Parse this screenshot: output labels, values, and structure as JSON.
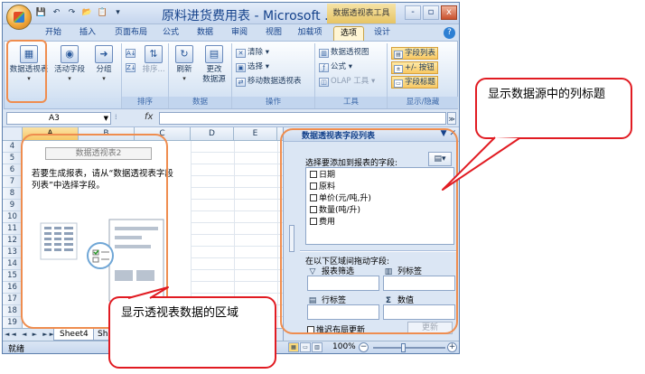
{
  "window": {
    "title": "原料进货费用表 - Microsoft ...",
    "context_tab_title": "数据透视表工具",
    "controls": [
      "-",
      "▫",
      "x"
    ]
  },
  "quick_access": [
    "💾",
    "↶",
    "↷",
    "📂",
    "📋",
    "▾"
  ],
  "ribbon_tabs": [
    {
      "label": "开始"
    },
    {
      "label": "插入"
    },
    {
      "label": "页面布局"
    },
    {
      "label": "公式"
    },
    {
      "label": "数据"
    },
    {
      "label": "审阅"
    },
    {
      "label": "视图"
    },
    {
      "label": "加载项"
    },
    {
      "label": "选项"
    },
    {
      "label": "设计"
    }
  ],
  "ribbon": {
    "pivottable": {
      "label": "数据透视表",
      "dropdown": "▾"
    },
    "active_field": {
      "label": "活动字段",
      "dropdown": "▾"
    },
    "group": {
      "label": "分组",
      "dropdown": "▾"
    },
    "sort": {
      "label": "排序...",
      "group_label": "排序"
    },
    "refresh": {
      "label": "刷新",
      "dropdown": "▾"
    },
    "change_source": {
      "label1": "更改",
      "label2": "数据源",
      "dropdown": "▾"
    },
    "data_group_label": "数据",
    "clear": {
      "label": "清除",
      "dropdown": "▾"
    },
    "select": {
      "label": "选择",
      "dropdown": "▾"
    },
    "move": {
      "label": "移动数据透视表"
    },
    "actions_group_label": "操作",
    "pivot_chart": {
      "label": "数据透视图"
    },
    "formula": {
      "label": "公式",
      "dropdown": "▾"
    },
    "olap": {
      "label": "OLAP 工具",
      "dropdown": "▾"
    },
    "tools_group_label": "工具",
    "field_list_btn": {
      "label": "字段列表"
    },
    "plusminus_btn": {
      "label": "+/- 按钮"
    },
    "field_header_btn": {
      "label": "字段标题"
    },
    "show_hide_group_label": "显示/隐藏"
  },
  "formula_bar": {
    "name_box": "A3",
    "fx": "fx",
    "value": ""
  },
  "sheet": {
    "columns": [
      "A",
      "B",
      "C",
      "D",
      "E",
      "F"
    ],
    "selected_column": "A",
    "rows": [
      "4",
      "5",
      "6",
      "7",
      "8",
      "9",
      "10",
      "11",
      "12",
      "13",
      "14",
      "15",
      "16",
      "17",
      "18",
      "19"
    ],
    "pivot_placeholder_title": "数据透视表2",
    "pivot_hint": "若要生成报表，请从“数据透视表字段列表”中选择字段。"
  },
  "sheet_tabs": {
    "nav": "◄◄ ◄ ► ►►",
    "tabs": [
      "Sheet4",
      "Sh"
    ]
  },
  "field_list": {
    "title": "数据透视表字段列表",
    "choose_label": "选择要添加到报表的字段:",
    "fields": [
      "日期",
      "原料",
      "单价(元/吨,升)",
      "数量(吨/升)",
      "费用"
    ],
    "drag_label": "在以下区域间拖动字段:",
    "zones": {
      "report_filter": "报表筛选",
      "column_labels": "列标签",
      "row_labels": "行标签",
      "values": "数值"
    },
    "defer_label": "推迟布局更新",
    "update_button": "更新"
  },
  "status_bar": {
    "ready": "就绪",
    "zoom": "100%",
    "zoom_minus": "−",
    "zoom_plus": "+"
  },
  "annotations": {
    "callout_columns": "显示数据源中的列标题",
    "callout_area": "显示透视表数据的区域"
  },
  "colors": {
    "highlight_orange": "#ef8d4f",
    "callout_red": "#e11b22",
    "ribbon_blue": "#dbe6f4"
  }
}
